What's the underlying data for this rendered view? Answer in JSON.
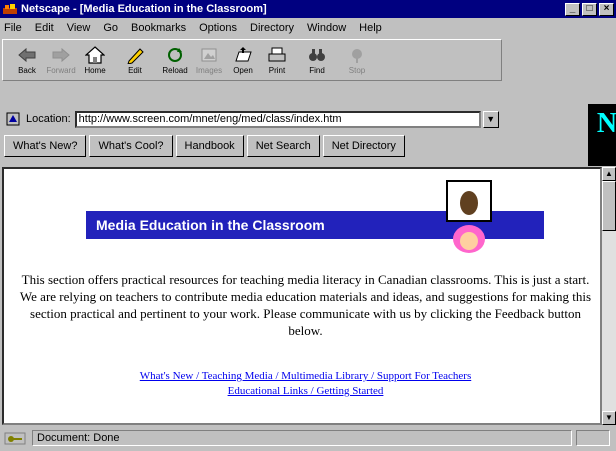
{
  "window": {
    "title": "Netscape - [Media Education in the Classroom]"
  },
  "menu": [
    "File",
    "Edit",
    "View",
    "Go",
    "Bookmarks",
    "Options",
    "Directory",
    "Window",
    "Help"
  ],
  "toolbar": [
    {
      "label": "Back",
      "icon": "back-arrow-icon",
      "enabled": true
    },
    {
      "label": "Forward",
      "icon": "forward-arrow-icon",
      "enabled": false
    },
    {
      "label": "Home",
      "icon": "home-icon",
      "enabled": true
    },
    {
      "label": "Edit",
      "icon": "edit-pencil-icon",
      "enabled": true
    },
    {
      "label": "Reload",
      "icon": "reload-icon",
      "enabled": true
    },
    {
      "label": "Images",
      "icon": "images-icon",
      "enabled": false
    },
    {
      "label": "Open",
      "icon": "open-icon",
      "enabled": true
    },
    {
      "label": "Print",
      "icon": "print-icon",
      "enabled": true
    },
    {
      "label": "Find",
      "icon": "find-binoculars-icon",
      "enabled": true
    },
    {
      "label": "Stop",
      "icon": "stop-icon",
      "enabled": false
    }
  ],
  "location": {
    "label": "Location:",
    "url": "http://www.screen.com/mnet/eng/med/class/index.htm"
  },
  "directory_buttons": [
    "What's New?",
    "What's Cool?",
    "Handbook",
    "Net Search",
    "Net Directory"
  ],
  "logo": {
    "letter": "N"
  },
  "page": {
    "banner": "Media Education in the Classroom",
    "paragraph": "This section offers practical resources for teaching media literacy in Canadian classrooms. This is just a start. We are relying on teachers to contribute media education materials and ideas, and suggestions for making this section practical and pertinent to your work. Please communicate with us by clicking the Feedback button below.",
    "links_line1": "What's New / Teaching Media / Multimedia Library / Support For Teachers",
    "links_line2": "Educational Links / Getting Started"
  },
  "status": {
    "text": "Document: Done"
  },
  "colors": {
    "titlebar": "#000080",
    "banner": "#2222bb",
    "link": "#0000ee"
  }
}
